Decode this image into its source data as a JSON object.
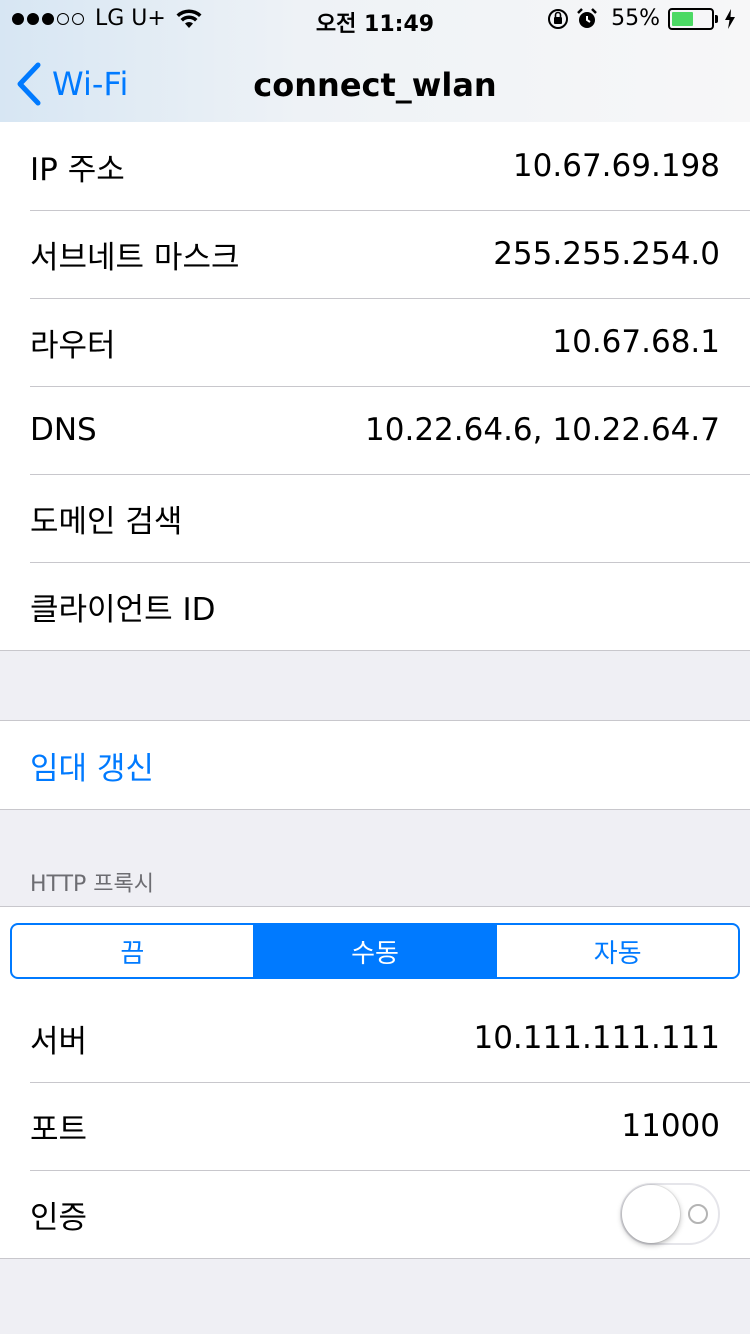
{
  "status_bar": {
    "carrier": "LG U+",
    "time": "오전 11:49",
    "battery_pct": "55%",
    "battery_level": 0.55,
    "icons": [
      "signal-dots-icon",
      "wifi-icon",
      "orientation-lock-icon",
      "alarm-icon",
      "battery-icon",
      "charging-bolt-icon"
    ]
  },
  "nav": {
    "back_label": "Wi-Fi",
    "title": "connect_wlan"
  },
  "ip_info": [
    {
      "label": "IP 주소",
      "value": "10.67.69.198"
    },
    {
      "label": "서브네트 마스크",
      "value": "255.255.254.0"
    },
    {
      "label": "라우터",
      "value": "10.67.68.1"
    },
    {
      "label": "DNS",
      "value": "10.22.64.6, 10.22.64.7"
    },
    {
      "label": "도메인 검색",
      "value": ""
    },
    {
      "label": "클라이언트 ID",
      "value": ""
    }
  ],
  "renew_lease": "임대 갱신",
  "proxy": {
    "header": "HTTP 프록시",
    "segments": [
      "끔",
      "수동",
      "자동"
    ],
    "selected": "수동",
    "server_label": "서버",
    "server_value": "10.111.111.111",
    "port_label": "포트",
    "port_value": "11000",
    "auth_label": "인증",
    "auth_on": false
  },
  "colors": {
    "accent": "#007aff",
    "background": "#efeff4",
    "separator": "#c8c7cc",
    "battery_fill": "#4cd964"
  }
}
